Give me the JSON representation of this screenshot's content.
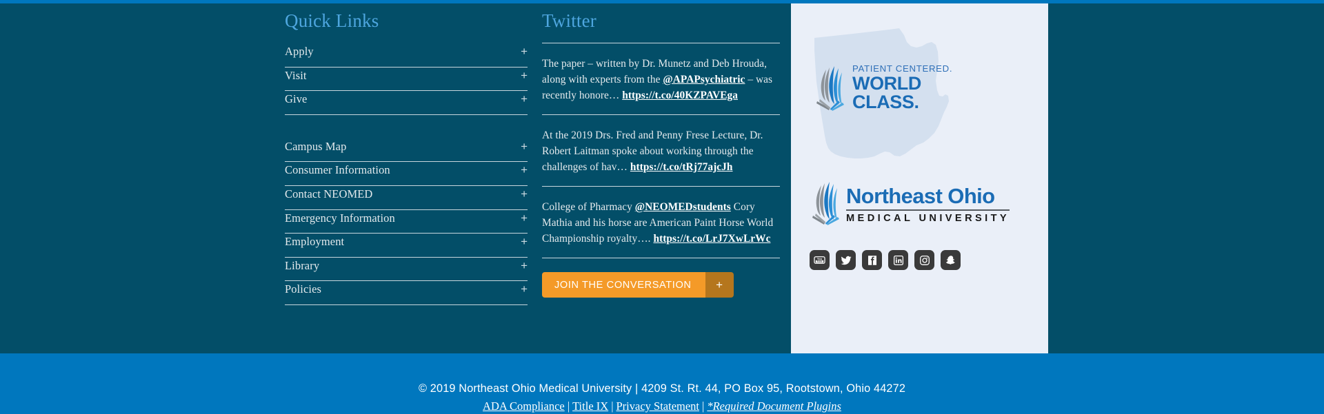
{
  "colors": {
    "background": "#034e68",
    "top_stripe": "#0077be",
    "footer": "#0077be",
    "panel": "#eaeff8",
    "heading": "#4ea6df",
    "button_orange": "#f49a28",
    "button_orange_dark": "#b5761d",
    "brand_blue": "#1b6cb5"
  },
  "quick_links": {
    "title": "Quick Links",
    "group_one": [
      {
        "label": "Apply",
        "expand": "+"
      },
      {
        "label": "Visit",
        "expand": "+"
      },
      {
        "label": "Give",
        "expand": "+"
      }
    ],
    "group_two": [
      {
        "label": "Campus Map",
        "expand": "+"
      },
      {
        "label": "Consumer Information",
        "expand": "+"
      },
      {
        "label": "Contact NEOMED",
        "expand": "+"
      },
      {
        "label": "Emergency Information",
        "expand": "+"
      },
      {
        "label": "Employment",
        "expand": "+"
      },
      {
        "label": "Library",
        "expand": "+"
      },
      {
        "label": "Policies",
        "expand": "+"
      }
    ]
  },
  "twitter": {
    "title": "Twitter",
    "tweets": [
      {
        "part1": "The paper – written by Dr. Munetz and Deb Hrouda, along with experts from the ",
        "handle": "@APAPsychiatric",
        "part2": " – was recently honore… ",
        "link": "https://t.co/40KZPAVEga"
      },
      {
        "part1": "At the 2019 Drs. Fred and Penny Frese Lecture, Dr. Robert Laitman spoke about working through the challenges of hav… ",
        "handle": "",
        "part2": "",
        "link": "https://t.co/tRj77ajcJh"
      },
      {
        "part1": "College of Pharmacy ",
        "handle": "@NEOMEDstudents",
        "part2": " Cory Mathia and his horse are American Paint Horse World Championship royalty…. ",
        "link": "https://t.co/LrJ7XwLrWc"
      }
    ],
    "join_button": {
      "label": "JOIN THE CONVERSATION",
      "expand": "+"
    }
  },
  "panel": {
    "tagline": {
      "line1": "PATIENT CENTERED.",
      "line2": "WORLD",
      "line3": "CLASS."
    },
    "logo": {
      "name": "Northeast Ohio",
      "subtitle": "MEDICAL UNIVERSITY"
    },
    "social": [
      {
        "name": "youtube-icon",
        "label": "YouTube"
      },
      {
        "name": "twitter-icon",
        "label": "Twitter"
      },
      {
        "name": "facebook-icon",
        "label": "Facebook"
      },
      {
        "name": "linkedin-icon",
        "label": "LinkedIn"
      },
      {
        "name": "instagram-icon",
        "label": "Instagram"
      },
      {
        "name": "snapchat-icon",
        "label": "Snapchat"
      }
    ]
  },
  "footer": {
    "copyright": "©  2019 Northeast Ohio Medical University | 4209 St. Rt. 44, PO Box 95, Rootstown, Ohio 44272",
    "links": [
      {
        "label": "ADA Compliance",
        "italic": false
      },
      {
        "label": "Title IX",
        "italic": false
      },
      {
        "label": "Privacy Statement",
        "italic": false
      },
      {
        "label": "*Required Document Plugins",
        "italic": true
      }
    ],
    "separator": "|"
  }
}
